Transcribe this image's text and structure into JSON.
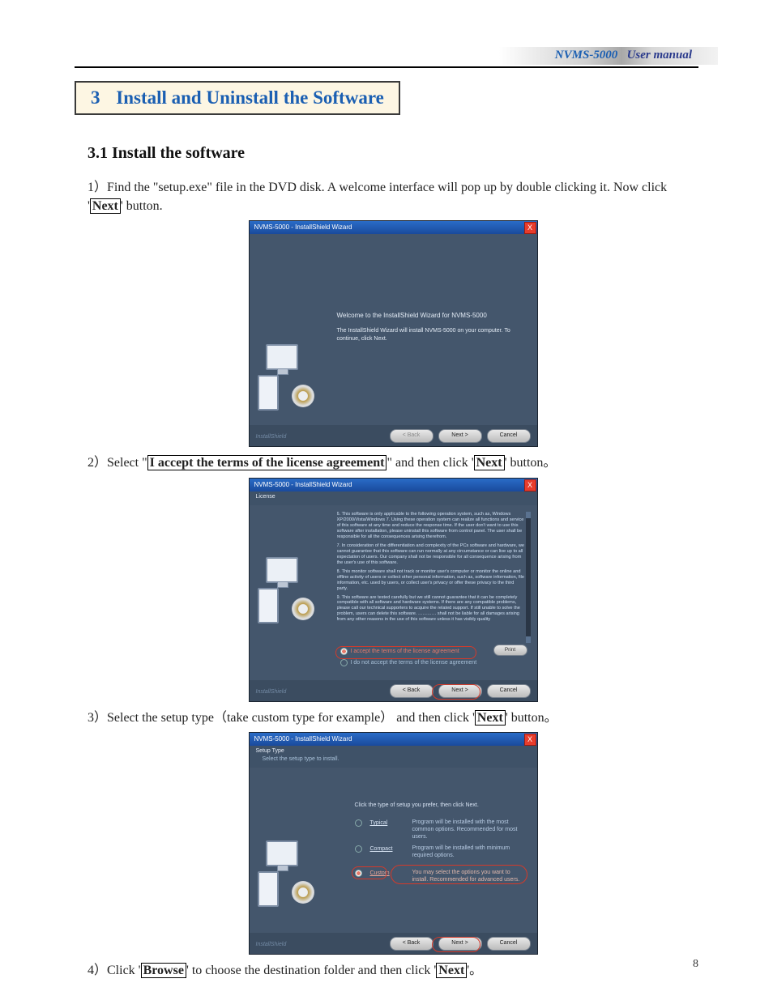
{
  "header": {
    "product": "NVMS-5000",
    "manual": "User manual"
  },
  "chapter": {
    "num": "3",
    "title": "Install and Uninstall the Software"
  },
  "section": {
    "num_title": "3.1 Install the software"
  },
  "steps": {
    "s1_a": "1）Find the \"setup.exe\" file in the DVD disk. A welcome interface will pop up by double clicking it. Now click '",
    "s1_next": "Next",
    "s1_b": "' button.",
    "s2_a": "2）Select \"",
    "s2_accept": "I accept the terms of the license agreement",
    "s2_b": "\" and then click '",
    "s2_next": "Next",
    "s2_c": "' button。",
    "s3_a": "3）Select the setup type（take custom type for example） and then click '",
    "s3_next": "Next",
    "s3_b": "' button。",
    "s4_a": "4）Click '",
    "s4_browse": "Browse",
    "s4_b": "' to choose the destination folder and then click '",
    "s4_next": "Next",
    "s4_c": "'。"
  },
  "wiz_common": {
    "title": "NVMS-5000 - InstallShield Wizard",
    "close": "X",
    "brand": "InstallShield",
    "back": "< Back",
    "next": "Next >",
    "cancel": "Cancel"
  },
  "wiz1": {
    "h": "Welcome to the InstallShield Wizard for NVMS-5000",
    "p": "The InstallShield Wizard will install NVMS-5000 on your computer. To continue, click Next."
  },
  "wiz2": {
    "sub_a": "License",
    "lic6": "6. This software is only applicable to the following operation system, such as, Windows XP/2000/Vista/Windows 7. Using these operation system can realize all functions and service of this software at any time and reduce the response time. If the user don't want to use this software after installation, please uninstall this software from control panel. The user shall be responsible for all the consequences arising therefrom.",
    "lic7": "7. In consideration of the differentiation and complexity of the PCs software and hardware, we cannot guarantee that this software can run normally at any circumstance or can live up to all expectation of users. Our company shall not be responsible for all consequence arising from the user's use of this software.",
    "lic8": "8. This monitor software shall not track or monitor user's computer or monitor the online and offline activity of users or collect other personal information, such as, software information, file information, etc. used by users, or collect user's privacy or offer these privacy to the third party.",
    "lic9": "9. This software are tested carefully but we still cannot guarantee that it can be completely compatible with all software and hardware systems. If there are any compatible problems, please call our technical supporters to acquire the related support. If still unable to solve the problem, users can delete this software. ………… shall not be liable for all damages arising from any other reasons in the use of this software unless it has visibly quality",
    "accept": "I accept the terms of the license agreement",
    "reject": "I do not accept the terms of the license agreement",
    "print": "Print"
  },
  "wiz3": {
    "sub_a": "Setup Type",
    "sub_b": "Select the setup type to install.",
    "intro": "Click the type of setup you prefer, then click Next.",
    "typical_l": "Typical",
    "typical_d": "Program will be installed with the most common options. Recommended for most users.",
    "compact_l": "Compact",
    "compact_d": "Program will be installed with minimum required options.",
    "custom_l": "Custom",
    "custom_d": "You may select the options you want to install. Recommended for advanced users."
  },
  "page_number": "8"
}
